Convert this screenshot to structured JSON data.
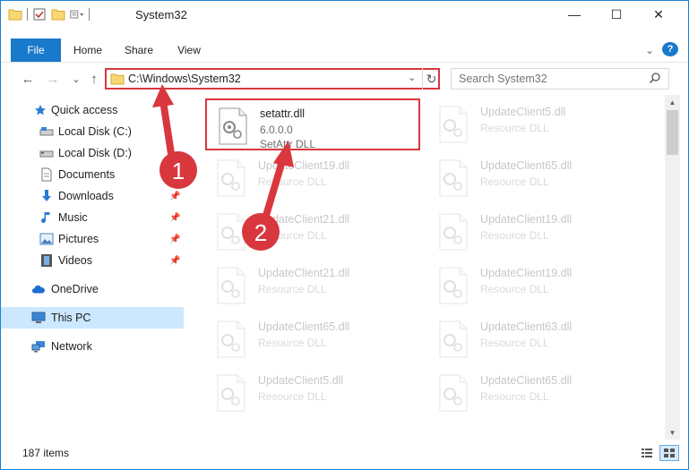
{
  "window": {
    "title": "System32",
    "minimize_glyph": "—",
    "maximize_glyph": "☐",
    "close_glyph": "✕"
  },
  "ribbon": {
    "tabs": [
      "File",
      "Home",
      "Share",
      "View"
    ],
    "collapse_glyph": "⌄",
    "help_glyph": "?"
  },
  "navigation": {
    "back_glyph": "←",
    "forward_glyph": "→",
    "recent_glyph": "⌄",
    "up_glyph": "↑"
  },
  "address_bar": {
    "path": "C:\\Windows\\System32",
    "dropdown_glyph": "⌄",
    "refresh_glyph": "↻"
  },
  "search": {
    "placeholder": "Search System32"
  },
  "sidebar": {
    "items": [
      {
        "label": "Quick access",
        "icon": "star-icon"
      },
      {
        "label": "Local Disk (C:)",
        "icon": "drive-icon"
      },
      {
        "label": "Local Disk (D:)",
        "icon": "drive-icon"
      },
      {
        "label": "Documents",
        "icon": "documents-icon"
      },
      {
        "label": "Downloads",
        "icon": "download-icon"
      },
      {
        "label": "Music",
        "icon": "music-icon"
      },
      {
        "label": "Pictures",
        "icon": "pictures-icon"
      },
      {
        "label": "Videos",
        "icon": "videos-icon"
      },
      {
        "label": "OneDrive",
        "icon": "cloud-icon"
      },
      {
        "label": "This PC",
        "icon": "computer-icon"
      },
      {
        "label": "Network",
        "icon": "network-icon"
      }
    ]
  },
  "files": [
    {
      "name": "setattr.dll",
      "version": "6.0.0.0",
      "type": "SetAttr DLL"
    },
    {
      "name": "UpdateClient5.dll",
      "type": "Resource DLL"
    },
    {
      "name": "UpdateClient19.dll",
      "type": "Resource DLL"
    },
    {
      "name": "UpdateClient65.dll",
      "type": "Resource DLL"
    },
    {
      "name": "UpdateClient21.dll",
      "type": "Resource DLL"
    },
    {
      "name": "UpdateClient19.dll",
      "type": "Resource DLL"
    },
    {
      "name": "UpdateClient21.dll",
      "type": "Resource DLL"
    },
    {
      "name": "UpdateClient19.dll",
      "type": "Resource DLL"
    },
    {
      "name": "UpdateClient65.dll",
      "type": "Resource DLL"
    },
    {
      "name": "UpdateClient63.dll",
      "type": "Resource DLL"
    },
    {
      "name": "UpdateClient5.dll",
      "type": "Resource DLL"
    },
    {
      "name": "UpdateClient65.dll",
      "type": "Resource DLL"
    }
  ],
  "status": {
    "item_count": "187 items"
  },
  "annotations": {
    "step1": "1",
    "step2": "2",
    "color": "#d9373e"
  },
  "colors": {
    "accent": "#1979ca",
    "selection": "#cce8ff",
    "highlight_border": "#d9373e"
  }
}
